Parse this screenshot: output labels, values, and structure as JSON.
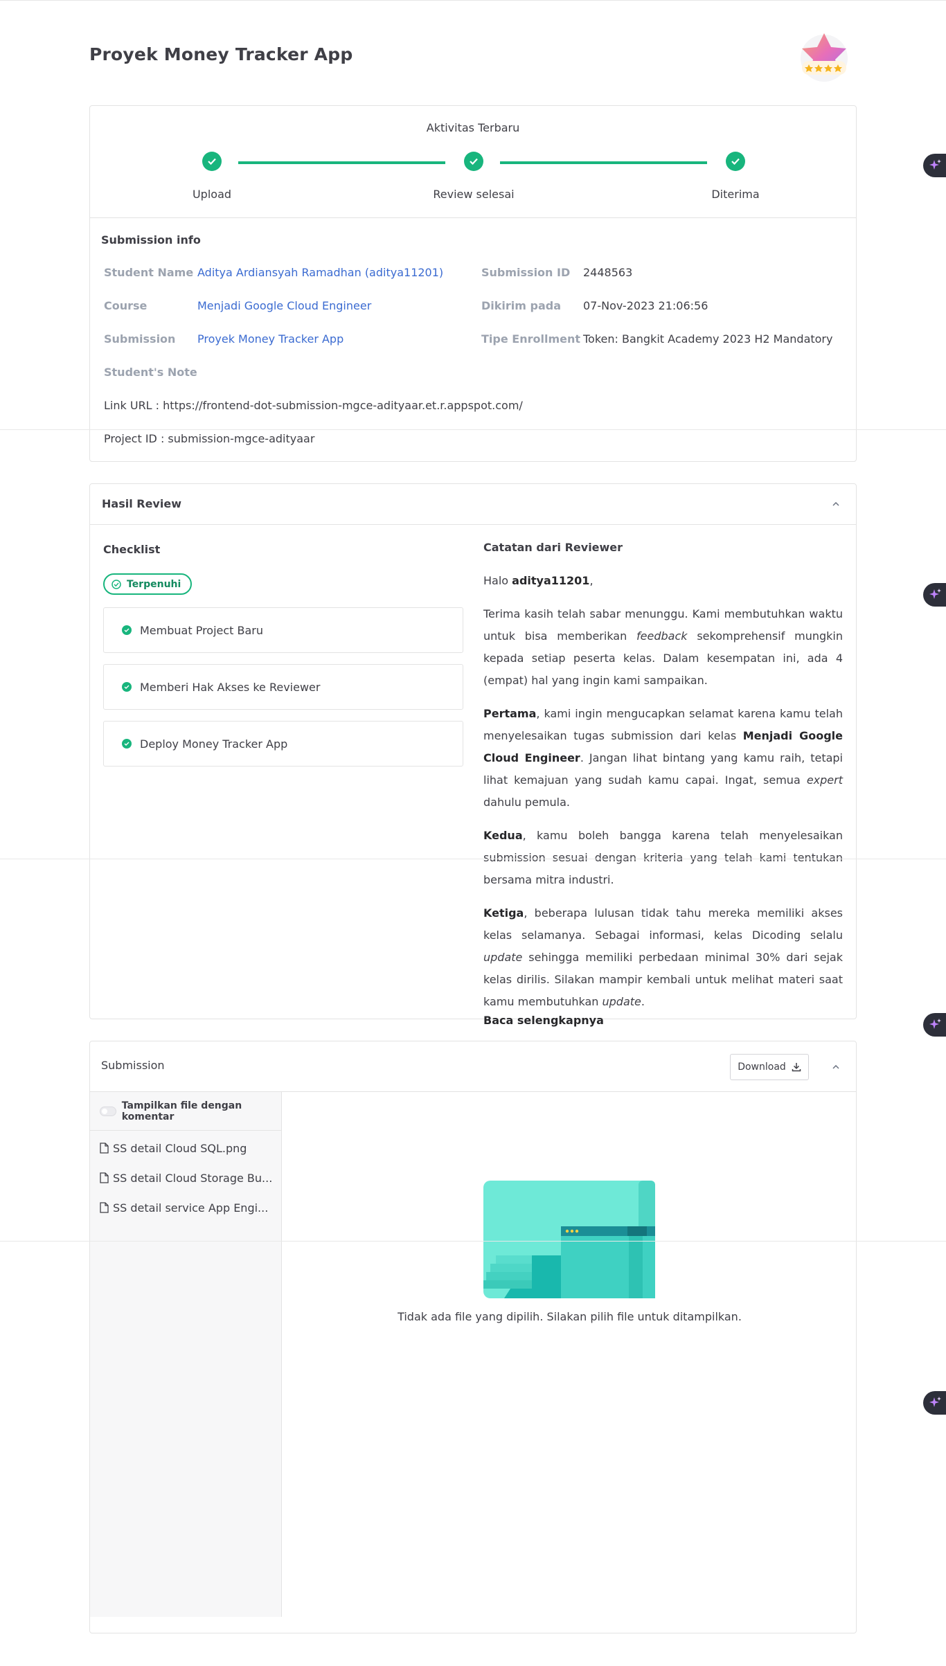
{
  "page": {
    "title": "Proyek Money Tracker App"
  },
  "progress": {
    "title": "Aktivitas Terbaru",
    "steps": [
      "Upload",
      "Review selesai",
      "Diterima"
    ]
  },
  "submission_info": {
    "title": "Submission info",
    "student_name_label": "Student Name",
    "student_name": "Aditya Ardiansyah Ramadhan (aditya11201)",
    "course_label": "Course",
    "course": "Menjadi Google Cloud Engineer",
    "submission_label": "Submission",
    "submission": "Proyek Money Tracker App",
    "submission_id_label": "Submission ID",
    "submission_id": "2448563",
    "sent_label": "Dikirim pada",
    "sent": "07-Nov-2023 21:06:56",
    "enrollment_label": "Tipe Enrollment",
    "enrollment": "Token: Bangkit Academy 2023 H2 Mandatory",
    "note_label": "Student's Note",
    "link_url": "Link URL : https://frontend-dot-submission-mgce-adityaar.et.r.appspot.com/",
    "project_id": "Project ID : submission-mgce-adityaar"
  },
  "review": {
    "title": "Hasil Review",
    "checklist_title": "Checklist",
    "status_pill": "Terpenuhi",
    "checklist": [
      "Membuat Project Baru",
      "Memberi Hak Akses ke Reviewer",
      "Deploy Money Tracker App"
    ],
    "notes_title": "Catatan dari Reviewer",
    "greeting_prefix": "Halo ",
    "greeting_user": "aditya11201",
    "greeting_suffix": ",",
    "p1_a": "Terima kasih telah sabar menunggu. Kami membutuhkan waktu untuk bisa memberikan ",
    "p1_em": "feedback",
    "p1_b": " sekomprehensif mungkin kepada setiap peserta kelas. Dalam kesempatan ini, ada 4 (empat) hal yang ingin kami sampaikan.",
    "p2_strong1": "Pertama",
    "p2_a": ", kami ingin mengucapkan selamat karena kamu telah menyelesaikan tugas submission dari kelas ",
    "p2_strong2": "Menjadi Google Cloud Engineer",
    "p2_b": ". Jangan lihat bintang yang kamu raih, tetapi lihat kemajuan yang sudah kamu capai. Ingat, semua ",
    "p2_em": "expert",
    "p2_c": " dahulu pemula.",
    "p3_strong": "Kedua",
    "p3_a": ", kamu boleh bangga karena telah menyelesaikan submission sesuai dengan kriteria yang telah kami tentukan bersama mitra industri.",
    "p4_strong": "Ketiga",
    "p4_a": ", beberapa lulusan tidak tahu mereka memiliki akses kelas selamanya. Sebagai informasi, kelas Dicoding selalu ",
    "p4_em": "update",
    "p4_b": " sehingga memiliki perbedaan minimal 30% dari sejak kelas dirilis. Silakan mampir kembali untuk melihat materi saat kamu membutuhkan ",
    "p4_em2": "update",
    "p4_c": ".",
    "read_more": "Baca selengkapnya"
  },
  "submission": {
    "title": "Submission",
    "download_label": "Download",
    "toggle_label": "Tampilkan file dengan komentar",
    "files": [
      "SS detail Cloud SQL.png",
      "SS detail Cloud Storage Bu...",
      "SS detail service App Engi..."
    ],
    "empty_message": "Tidak ada file yang dipilih. Silakan pilih file untuk ditampilkan."
  },
  "colors": {
    "accent_green": "#18b57d",
    "link_blue": "#3b6bd1",
    "fab_dark": "#2d2f3a"
  },
  "icons": [
    "check-icon",
    "chevron-up-icon",
    "download-icon",
    "file-icon",
    "sparkle-icon",
    "star-badge-icon",
    "empty-state-illustration"
  ]
}
